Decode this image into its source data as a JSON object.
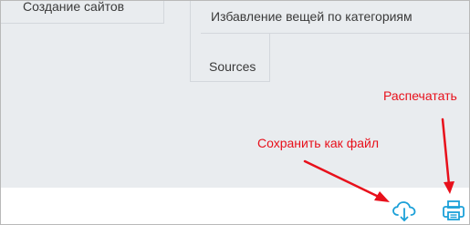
{
  "menu": {
    "left_item": "Создание сайтов",
    "right_item": "Избавление вещей по категориям",
    "sources_item": "Sources"
  },
  "annotations": {
    "save": "Сохранить как файл",
    "print": "Распечатать"
  },
  "colors": {
    "annotation": "#e8101b",
    "icon": "#1ba0d8",
    "background": "#e9ecef"
  },
  "icons": {
    "save": "cloud-download-icon",
    "print": "printer-icon"
  }
}
